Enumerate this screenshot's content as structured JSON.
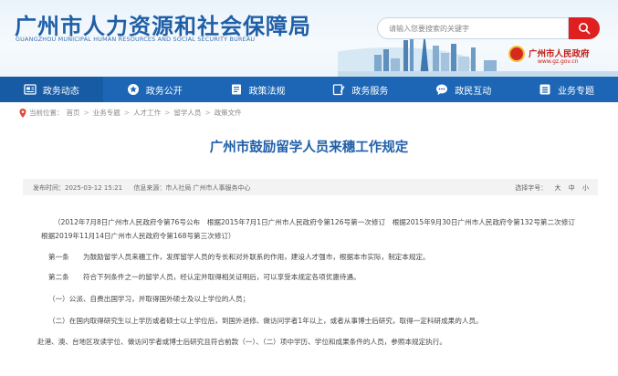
{
  "header": {
    "site_title": "广州市人力资源和社会保障局",
    "site_subtitle": "GUANGZHOU MUNICIPAL HUMAN RESOURCES AND SOCIAL SECURITY BUREAU",
    "search_placeholder": "请输入您要搜索的关键字",
    "gov_name": "广州市人民政府",
    "gov_url": "www.gz.gov.cn"
  },
  "nav": [
    {
      "label": "政务动态",
      "icon": "newspaper-icon"
    },
    {
      "label": "政务公开",
      "icon": "star-icon"
    },
    {
      "label": "政策法规",
      "icon": "book-icon"
    },
    {
      "label": "政务服务",
      "icon": "edit-icon"
    },
    {
      "label": "政民互动",
      "icon": "chat-icon"
    },
    {
      "label": "业务专题",
      "icon": "list-icon"
    }
  ],
  "breadcrumb": {
    "prefix": "当前位置：",
    "items": [
      "首页",
      "业务专题",
      "人才工作",
      "留学人员",
      "政策文件"
    ]
  },
  "article": {
    "title": "广州市鼓励留学人员来穗工作规定",
    "publish_time": "发布时间：2025-03-12 15:21",
    "source": "信息来源：市人社局 广州市人事服务中心",
    "font_size_label": "选择字号：",
    "font_sizes": [
      "大",
      "中",
      "小"
    ],
    "paragraphs": [
      "（2012年7月8日广州市人民政府令第76号公布　根据2015年7月1日广州市人民政府令第126号第一次修订　根据2015年9月30日广州市人民政府令第132号第二次修订　根据2019年11月14日广州市人民政府令第168号第三次修订）",
      "第一条　　为鼓励留学人员来穗工作，发挥留学人员的专长和对外联系的作用，建设人才强市，根据本市实际，制定本规定。",
      "第二条　　符合下列条件之一的留学人员，经认定并取得相关证明后，可以享受本规定各项优惠待遇。",
      "（一）公派、自费出国学习，并取得国外硕士及以上学位的人员；",
      "（二）在国内取得研究生以上学历或者硕士以上学位后，到国外进修、做访问学者1年以上，或者从事博士后研究，取得一定科研成果的人员。",
      "赴港、澳、台地区攻读学位、做访问学者或博士后研究且符合前款（一）、（二）项中学历、学位和成果条件的人员，参照本规定执行。"
    ]
  },
  "colors": {
    "primary_blue": "#1d66b5",
    "title_blue": "#1f5fa8",
    "search_red": "#e02020",
    "gov_red": "#c41b14"
  }
}
